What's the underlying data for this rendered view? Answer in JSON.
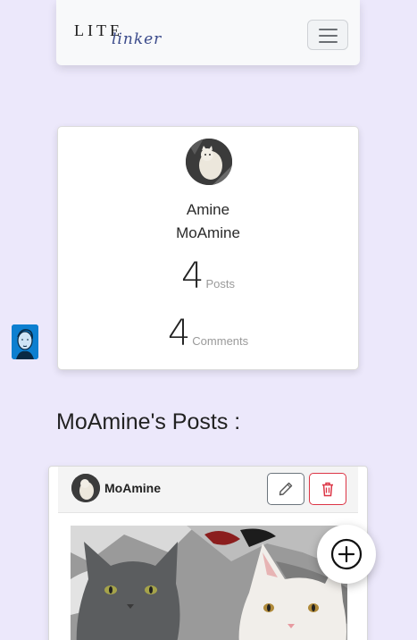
{
  "navbar": {
    "brand_primary": "LITE",
    "brand_secondary": "linker",
    "menu_icon": "hamburger-menu-icon"
  },
  "profile": {
    "first_name": "Amine",
    "username": "MoAmine",
    "posts_count": "4",
    "posts_label": "Posts",
    "comments_count": "4",
    "comments_label": "Comments"
  },
  "posts_section": {
    "title": "MoAmine's Posts :"
  },
  "post": {
    "author": "MoAmine",
    "edit_icon": "pencil-icon",
    "delete_icon": "trash-icon"
  },
  "fab": {
    "icon": "plus-circle-icon"
  },
  "colors": {
    "background": "#ece8fb",
    "danger": "#dc3545",
    "secondary": "#6c757d",
    "side_avatar": "#0d7fd0"
  }
}
